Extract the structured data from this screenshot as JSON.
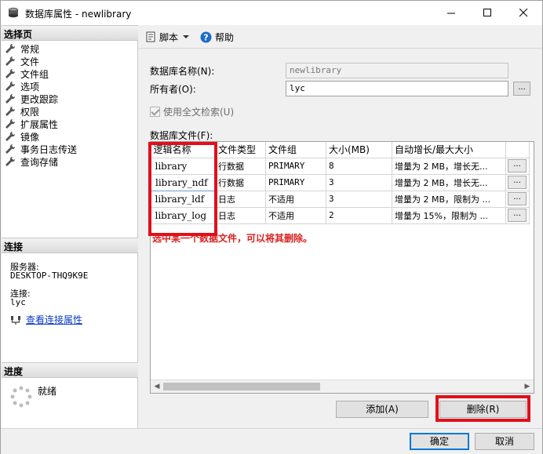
{
  "window": {
    "title": "数据库属性 - newlibrary"
  },
  "left": {
    "select_page_header": "选择页",
    "nav_items": [
      {
        "label": "常规"
      },
      {
        "label": "文件"
      },
      {
        "label": "文件组"
      },
      {
        "label": "选项"
      },
      {
        "label": "更改跟踪"
      },
      {
        "label": "权限"
      },
      {
        "label": "扩展属性"
      },
      {
        "label": "镜像"
      },
      {
        "label": "事务日志传送"
      },
      {
        "label": "查询存储"
      }
    ],
    "connection_header": "连接",
    "server_label": "服务器:",
    "server_value": "DESKTOP-THQ9K9E",
    "connection_label": "连接:",
    "connection_value": "lyc",
    "view_conn_link": "查看连接属性",
    "progress_header": "进度",
    "progress_status": "就绪"
  },
  "toolbar": {
    "script_label": "脚本",
    "help_label": "帮助"
  },
  "form": {
    "db_name_label": "数据库名称(N):",
    "db_name_value": "newlibrary",
    "owner_label": "所有者(O):",
    "owner_value": "lyc",
    "browse_label": "...",
    "fulltext_label": "使用全文检索(U)",
    "files_label": "数据库文件(F):"
  },
  "grid": {
    "headers": [
      "逻辑名称",
      "文件类型",
      "文件组",
      "大小(MB)",
      "自动增长/最大大小"
    ],
    "rows": [
      {
        "logical": "library",
        "type": "行数据",
        "filegroup": "PRIMARY",
        "size": "8",
        "growth": "增量为 2 MB，增长无..."
      },
      {
        "logical": "library_ndf",
        "type": "行数据",
        "filegroup": "PRIMARY",
        "size": "3",
        "growth": "增量为 2 MB，增长无..."
      },
      {
        "logical": "library_ldf",
        "type": "日志",
        "filegroup": "不适用",
        "size": "3",
        "growth": "增量为 2 MB，限制为 ..."
      },
      {
        "logical": "library_log",
        "type": "日志",
        "filegroup": "不适用",
        "size": "2",
        "growth": "增量为 15%，限制为 ..."
      }
    ],
    "cell_button": "..."
  },
  "annotation": "选中某一个数据文件，可以将其删除。",
  "buttons": {
    "add": "添加(A)",
    "remove": "删除(R)",
    "ok": "确定",
    "cancel": "取消"
  },
  "colors": {
    "highlight_red": "#e0101a",
    "annotation_red": "#e0201e",
    "link_blue": "#0a3cc8",
    "primary_border": "#0078d7"
  }
}
